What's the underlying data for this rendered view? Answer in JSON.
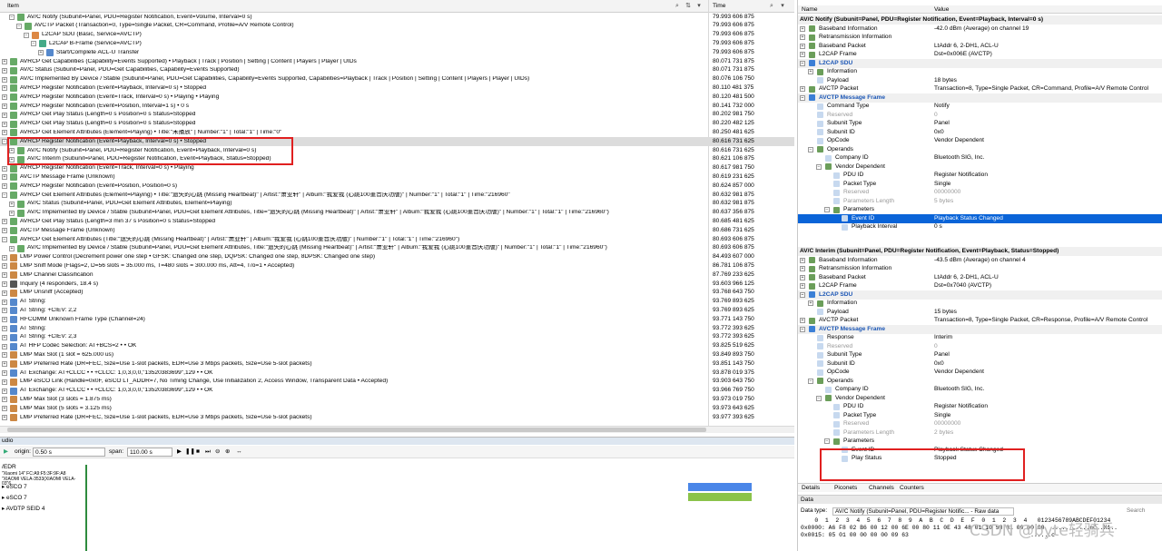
{
  "left": {
    "col_item": "Item",
    "col_time": "Time",
    "rows": [
      {
        "indent": 1,
        "plus": "⊟",
        "icon": "#6a6",
        "text": "AV/C Notify (Subunit=Panel, PDU=Register Notification, Event=Volume, Interval=0 s)",
        "time": "79.993 606 875"
      },
      {
        "indent": 2,
        "plus": "⊟",
        "icon": "#6a6",
        "text": "AVCTP Packet (Transaction=0, Type=Single Packet, CR=Command, Profile=A/V Remote Control)",
        "time": "79.993 606 875"
      },
      {
        "indent": 3,
        "plus": "⊟",
        "icon": "#d84",
        "text": "L2CAP SDU (Basic, Service=AVCTP)",
        "time": "79.993 606 875"
      },
      {
        "indent": 4,
        "plus": "⊟",
        "icon": "#4a8",
        "text": "L2CAP B-Frame (Service=AVCTP)",
        "time": "79.993 606 875"
      },
      {
        "indent": 5,
        "plus": "⊞",
        "icon": "#58c",
        "text": "Start/Complete ACL-U Transfer",
        "time": "79.993 606 875"
      },
      {
        "indent": 0,
        "plus": "⊞",
        "icon": "#6a6",
        "text": "AVRCP Get Capabilities (Capability=Events Supported) • Playback | Track | Position | Setting | Content | Players | Player | UIDs",
        "time": "80.071 731 875"
      },
      {
        "indent": 0,
        "plus": "⊞",
        "icon": "#6a6",
        "text": "AV/C Status (Subunit=Panel, PDU=Get Capabilities, Capability=Events Supported)",
        "time": "80.071 731 875"
      },
      {
        "indent": 0,
        "plus": "⊞",
        "icon": "#6a6",
        "text": "AV/C Implemented By Device / Stable (Subunit=Panel, PDU=Get Capabilities, Capability=Events Supported, Capabilities=Playback | Track | Position | Setting | Content | Players | Player | UIDs)",
        "time": "80.076 106 750"
      },
      {
        "indent": 0,
        "plus": "⊞",
        "icon": "#6a6",
        "text": "AVRCP Register Notification (Event=Playback, Interval=0 s) • Stopped",
        "time": "80.110 481 375"
      },
      {
        "indent": 0,
        "plus": "⊞",
        "icon": "#6a6",
        "text": "AVRCP Register Notification (Event=Track, Interval=0 s) • Playing • Playing",
        "time": "80.120 481 500"
      },
      {
        "indent": 0,
        "plus": "⊞",
        "icon": "#6a6",
        "text": "AVRCP Register Notification (Event=Position, Interval=1 s) • 0 s",
        "time": "80.141 732 000"
      },
      {
        "indent": 0,
        "plus": "⊞",
        "icon": "#6a6",
        "text": "AVRCP Get Play Status (Length=0 s Position=0 s Status=Stopped",
        "time": "80.202 981 750"
      },
      {
        "indent": 0,
        "plus": "⊞",
        "icon": "#6a6",
        "text": "AVRCP Get Play Status (Length=0 s Position=0 s Status=Stopped",
        "time": "80.220 482 125"
      },
      {
        "indent": 0,
        "plus": "⊞",
        "icon": "#6a6",
        "text": "AVRCP Get Element Attributes (Element=Playing) • Title:\"未播放\" | Number:\"1\" | Total:\"1\" | Time:\"0\"",
        "time": "80.250 481 625"
      },
      {
        "indent": 0,
        "plus": "⊟",
        "icon": "#6a6",
        "text": "AVRCP Register Notification (Event=Playback, Interval=0 s) • Stopped",
        "time": "80.616 731 625",
        "sel": true
      },
      {
        "indent": 1,
        "plus": "⊞",
        "icon": "#6a6",
        "text": "AV/C Notify (Subunit=Panel, PDU=Register Notification, Event=Playback, Interval=0 s)",
        "time": "80.616 731 625"
      },
      {
        "indent": 1,
        "plus": "⊞",
        "icon": "#6a6",
        "text": "AV/C Interim (Subunit=Panel, PDU=Register Notification, Event=Playback, Status=Stopped)",
        "time": "80.621 106 875"
      },
      {
        "indent": 0,
        "plus": "⊞",
        "icon": "#6a6",
        "text": "AVRCP Register Notification (Event=Track, Interval=0 s) • Playing",
        "time": "80.617 981 750"
      },
      {
        "indent": 0,
        "plus": "⊞",
        "icon": "#6a6",
        "text": "AVCTP Message Frame (Unknown)",
        "time": "80.619 231 625"
      },
      {
        "indent": 0,
        "plus": "⊞",
        "icon": "#6a6",
        "text": "AVRCP Register Notification (Event=Position, Position=0 s)",
        "time": "80.624 857 000"
      },
      {
        "indent": 0,
        "plus": "⊟",
        "icon": "#6a6",
        "text": "AVRCP Get Element Attributes (Element=Playing) • Title:\"遗失的心跳 (Missing Heartbeat)\" | Artist:\"萧亚轩\" | Album:\"我爱我 (心跳100重音庆功版)\" | Number:\"1\" | Total:\"1\" | Time:\"216960\"",
        "time": "80.632 981 875"
      },
      {
        "indent": 1,
        "plus": "⊞",
        "icon": "#6a6",
        "text": "AV/C Status (Subunit=Panel, PDU=Get Element Attributes, Element=Playing)",
        "time": "80.632 981 875"
      },
      {
        "indent": 1,
        "plus": "⊞",
        "icon": "#6a6",
        "text": "AV/C Implemented By Device / Stable (Subunit=Panel, PDU=Get Element Attributes, Title=\"遗失的心跳 (Missing Heartbeat)\" | Artist:\"萧亚轩\" | Album:\"我爱我 (心跳100重音庆功版)\" | Number:\"1\" | Total:\"1\" | Time:\"216960\")",
        "time": "80.637 356 875"
      },
      {
        "indent": 0,
        "plus": "⊞",
        "icon": "#6a6",
        "text": "AVRCP Get Play Status (Length=3 min 37 s Position=0 s Status=Stopped",
        "time": "80.685 481 625"
      },
      {
        "indent": 0,
        "plus": "⊞",
        "icon": "#6a6",
        "text": "AVCTP Message Frame (Unknown)",
        "time": "80.686 731 625"
      },
      {
        "indent": 0,
        "plus": "⊟",
        "icon": "#6a6",
        "text": "AVRCP Get Element Attributes (Title:\"遗失的心跳 (Missing Heartbeat)\" | Artist:\"萧亚轩\" | Album:\"我爱我 (心跳100重音庆功版)\" | Number:\"1\" | Total:\"1\" | Time:\"216960\")",
        "time": "80.693 606 875"
      },
      {
        "indent": 1,
        "plus": "⊞",
        "icon": "#6a6",
        "text": "AV/C Implemented By Device / Stable (Subunit=Panel, PDU=Get Element Attributes, Title:\"遗失的心跳 (Missing Heartbeat)\" | Artist:\"萧亚轩\" | Album:\"我爱我 (心跳100重音庆功版)\" | Number:\"1\" | Total:\"1\" | Time:\"216960\")",
        "time": "80.693 606 875"
      },
      {
        "indent": 0,
        "plus": "⊞",
        "icon": "#c84",
        "text": "LMP Power Control (Decrement power one step • GFSK: Changed one step, DQPSK: Changed one step, 8DPSK: Changed one step)",
        "time": "84.493 607 000"
      },
      {
        "indent": 0,
        "plus": "⊞",
        "icon": "#c84",
        "text": "LMP Sniff Mode (Flags=2, D=56 slots = 35.000 ms, T=480 slots = 300.000 ms, Att=4, T/o=1 • Accepted)",
        "time": "86.781 106 875"
      },
      {
        "indent": 0,
        "plus": "⊞",
        "icon": "#c84",
        "text": "LMP Channel Classification",
        "time": "87.769 233 625"
      },
      {
        "indent": 0,
        "plus": "⊞",
        "icon": "#555",
        "text": "Inquiry (4 responders, 18.4 s)",
        "time": "93.603 966 125"
      },
      {
        "indent": 0,
        "plus": "⊞",
        "icon": "#c84",
        "text": "LMP Unsniff (Accepted)",
        "time": "93.768 643 750"
      },
      {
        "indent": 0,
        "plus": "⊞",
        "icon": "#58c",
        "text": "AT String:",
        "time": "93.769 893 625"
      },
      {
        "indent": 0,
        "plus": "⊞",
        "icon": "#58c",
        "text": "AT String: +CIEV: 2,2",
        "time": "93.769 893 625"
      },
      {
        "indent": 0,
        "plus": "⊞",
        "icon": "#58c",
        "text": "RFCOMM Unknown Frame Type (Channel=24)",
        "time": "93.771 143 750"
      },
      {
        "indent": 0,
        "plus": "⊞",
        "icon": "#58c",
        "text": "AT String:",
        "time": "93.772 393 625"
      },
      {
        "indent": 0,
        "plus": "⊞",
        "icon": "#58c",
        "text": "AT String: +CIEV: 2,3",
        "time": "93.772 393 625"
      },
      {
        "indent": 0,
        "plus": "⊞",
        "icon": "#58c",
        "text": "AT HFP Codec Selection: AT+BCS=2 • • OK",
        "time": "93.825 519 625"
      },
      {
        "indent": 0,
        "plus": "⊞",
        "icon": "#c84",
        "text": "LMP Max Slot (1 slot = 625.000 us)",
        "time": "93.849 893 750"
      },
      {
        "indent": 0,
        "plus": "⊞",
        "icon": "#c84",
        "text": "LMP Preferred Rate (DR=FEC, Size=Use 1-slot packets, EDR=Use 3 Mbps packets, Size=Use 5-slot packets)",
        "time": "93.851 143 750"
      },
      {
        "indent": 0,
        "plus": "⊞",
        "icon": "#58c",
        "text": "AT Exchange: AT+CLCC • • +CLCC: 1,0,3,0,0,\"13520383699\",129 • • OK",
        "time": "93.878 019 375"
      },
      {
        "indent": 0,
        "plus": "⊞",
        "icon": "#c84",
        "text": "LMP eSCO Link (Handle=0x0F, eSCO LT_ADDR=7, No Timing Change, Use Initialization 2, Access Window, Transparent Data • Accepted)",
        "time": "93.903 643 750"
      },
      {
        "indent": 0,
        "plus": "⊞",
        "icon": "#58c",
        "text": "AT Exchange: AT+CLCC • • +CLCC: 1,0,3,0,0,\"13520383699\",129 • • OK",
        "time": "93.966 769 750"
      },
      {
        "indent": 0,
        "plus": "⊞",
        "icon": "#c84",
        "text": "LMP Max Slot (3 slots = 1.875 ms)",
        "time": "93.973 019 750"
      },
      {
        "indent": 0,
        "plus": "⊞",
        "icon": "#c84",
        "text": "LMP Max Slot (5 slots = 3.125 ms)",
        "time": "93.973 643 625"
      },
      {
        "indent": 0,
        "plus": "⊞",
        "icon": "#c84",
        "text": "LMP Preferred Rate (DR=FEC, Size=Use 1-slot packets, EDR=Use 3 Mbps packets, Size=Use 5-slot packets)",
        "time": "93.977 393 625"
      }
    ]
  },
  "audio": {
    "title": "udio",
    "origin_label": "origin:",
    "origin_value": "0.50 s",
    "span_label": "span:",
    "span_value": "110.00 s",
    "tracks": [
      "\"Xiaomi 14\" FC:A9:F5:3F:9F:A8",
      "\"XIAOMI VELA-3533(XIAOMI VELA-03\"6...",
      "eSCO 7",
      "eSCO 7",
      "AVDTP SEID 4"
    ],
    "edr": "/EDR"
  },
  "right": {
    "col_name": "Name",
    "col_value": "Value",
    "section1_title": "AV/C Notify (Subunit=Panel, PDU=Register Notification, Event=Playback, Interval=0 s)",
    "section2_title": "AV/C Interim (Subunit=Panel, PDU=Register Notification, Event=Playback, Status=Stopped)",
    "rows1": [
      {
        "indent": 0,
        "plus": "⊞",
        "k": "Baseband Information",
        "v": "-42.0 dBm (Average) on channel 19"
      },
      {
        "indent": 0,
        "plus": "⊞",
        "k": "Retransmission Information",
        "v": ""
      },
      {
        "indent": 0,
        "plus": "⊞",
        "k": "Baseband Packet",
        "v": "LtAddr 6, 2-DH1, ACL-U"
      },
      {
        "indent": 0,
        "plus": "⊞",
        "k": "L2CAP Frame",
        "v": "Dst=0x006E (AVCTP)"
      },
      {
        "indent": 0,
        "plus": "⊟",
        "k": "L2CAP SDU",
        "v": "",
        "sec": true
      },
      {
        "indent": 1,
        "plus": "⊞",
        "k": "Information",
        "v": ""
      },
      {
        "indent": 1,
        "plus": "",
        "k": "Payload",
        "v": "18 bytes"
      },
      {
        "indent": 0,
        "plus": "⊞",
        "k": "AVCTP Packet",
        "v": "Transaction=8, Type=Single Packet, CR=Command, Profile=A/V Remote Control"
      },
      {
        "indent": 0,
        "plus": "⊟",
        "k": "AVCTP Message Frame",
        "v": "",
        "sec": true
      },
      {
        "indent": 1,
        "plus": "",
        "k": "Command Type",
        "v": "Notify"
      },
      {
        "indent": 1,
        "plus": "",
        "k": "Reserved",
        "v": "0",
        "g": true
      },
      {
        "indent": 1,
        "plus": "",
        "k": "Subunit Type",
        "v": "Panel"
      },
      {
        "indent": 1,
        "plus": "",
        "k": "Subunit ID",
        "v": "0x0"
      },
      {
        "indent": 1,
        "plus": "",
        "k": "OpCode",
        "v": "Vendor Dependent"
      },
      {
        "indent": 1,
        "plus": "⊟",
        "k": "Operands",
        "v": ""
      },
      {
        "indent": 2,
        "plus": "",
        "k": "Company ID",
        "v": "Bluetooth SIG, Inc."
      },
      {
        "indent": 2,
        "plus": "⊟",
        "k": "Vendor Dependent",
        "v": ""
      },
      {
        "indent": 3,
        "plus": "",
        "k": "PDU ID",
        "v": "Register Notification"
      },
      {
        "indent": 3,
        "plus": "",
        "k": "Packet Type",
        "v": "Single"
      },
      {
        "indent": 3,
        "plus": "",
        "k": "Reserved",
        "v": "00000000",
        "g": true
      },
      {
        "indent": 3,
        "plus": "",
        "k": "Parameters Length",
        "v": "5 bytes",
        "g": true
      },
      {
        "indent": 3,
        "plus": "⊟",
        "k": "Parameters",
        "v": ""
      },
      {
        "indent": 4,
        "plus": "",
        "k": "Event ID",
        "v": "Playback Status Changed",
        "hl": true
      },
      {
        "indent": 4,
        "plus": "",
        "k": "Playback Interval",
        "v": "0 s"
      }
    ],
    "rows2": [
      {
        "indent": 0,
        "plus": "⊞",
        "k": "Baseband Information",
        "v": "-43.5 dBm (Average) on channel 4"
      },
      {
        "indent": 0,
        "plus": "⊞",
        "k": "Retransmission Information",
        "v": ""
      },
      {
        "indent": 0,
        "plus": "⊞",
        "k": "Baseband Packet",
        "v": "LtAddr 6, 2-DH1, ACL-U"
      },
      {
        "indent": 0,
        "plus": "⊞",
        "k": "L2CAP Frame",
        "v": "Dst=0x7040 (AVCTP)"
      },
      {
        "indent": 0,
        "plus": "⊟",
        "k": "L2CAP SDU",
        "v": "",
        "sec": true
      },
      {
        "indent": 1,
        "plus": "⊞",
        "k": "Information",
        "v": ""
      },
      {
        "indent": 1,
        "plus": "",
        "k": "Payload",
        "v": "15 bytes"
      },
      {
        "indent": 0,
        "plus": "⊞",
        "k": "AVCTP Packet",
        "v": "Transaction=8, Type=Single Packet, CR=Response, Profile=A/V Remote Control"
      },
      {
        "indent": 0,
        "plus": "⊟",
        "k": "AVCTP Message Frame",
        "v": "",
        "sec": true
      },
      {
        "indent": 1,
        "plus": "",
        "k": "Response",
        "v": "Interim"
      },
      {
        "indent": 1,
        "plus": "",
        "k": "Reserved",
        "v": "0",
        "g": true
      },
      {
        "indent": 1,
        "plus": "",
        "k": "Subunit Type",
        "v": "Panel"
      },
      {
        "indent": 1,
        "plus": "",
        "k": "Subunit ID",
        "v": "0x0"
      },
      {
        "indent": 1,
        "plus": "",
        "k": "OpCode",
        "v": "Vendor Dependent"
      },
      {
        "indent": 1,
        "plus": "⊟",
        "k": "Operands",
        "v": ""
      },
      {
        "indent": 2,
        "plus": "",
        "k": "Company ID",
        "v": "Bluetooth SIG, Inc."
      },
      {
        "indent": 2,
        "plus": "⊟",
        "k": "Vendor Dependent",
        "v": ""
      },
      {
        "indent": 3,
        "plus": "",
        "k": "PDU ID",
        "v": "Register Notification"
      },
      {
        "indent": 3,
        "plus": "",
        "k": "Packet Type",
        "v": "Single"
      },
      {
        "indent": 3,
        "plus": "",
        "k": "Reserved",
        "v": "00000000",
        "g": true
      },
      {
        "indent": 3,
        "plus": "",
        "k": "Parameters Length",
        "v": "2 bytes",
        "g": true
      },
      {
        "indent": 3,
        "plus": "⊟",
        "k": "Parameters",
        "v": ""
      },
      {
        "indent": 4,
        "plus": "",
        "k": "Event ID",
        "v": "Playback Status Changed"
      },
      {
        "indent": 4,
        "plus": "",
        "k": "Play Status",
        "v": "Stopped"
      }
    ],
    "tabs": [
      "Details",
      "Piconets",
      "Channels",
      "Counters"
    ],
    "data": {
      "title": "Data",
      "type_label": "Data type:",
      "type_value": "AV/C Notify (Subunit=Panel, PDU=Register Notific... - Raw data",
      "search": "Search",
      "ruler": "    0  1  2  3  4  5  6  7  8  9  A  B  C  D  E  F  0  1  2  3  4   0123456789ABCDEF01234",
      "line1": "0x0000: A6 F8 02 B6 00 12 00 6E 00 80 11 0E 43 48 01 10 58 31 00 00 00  ...........nC..X1..",
      "line2": "0x0015: 05 01 00 00 00 00 09 63                                   ......c"
    }
  },
  "watermark": "CSDN @byte轻骑兵"
}
